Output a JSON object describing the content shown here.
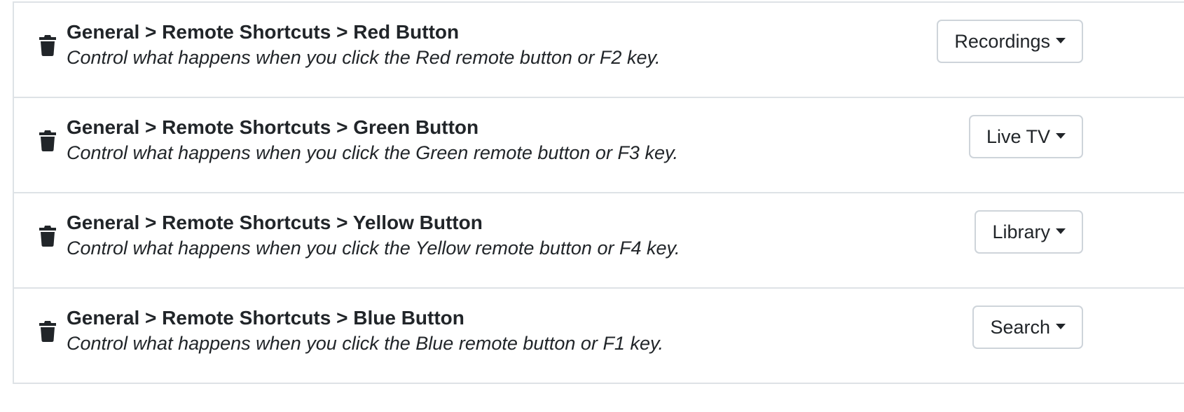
{
  "settings": [
    {
      "title": "General > Remote Shortcuts > Red Button",
      "description": "Control what happens when you click the Red remote button or F2 key.",
      "selected": "Recordings",
      "delete_icon": "trash-icon",
      "caret_icon": "caret-down-icon"
    },
    {
      "title": "General > Remote Shortcuts > Green Button",
      "description": "Control what happens when you click the Green remote button or F3 key.",
      "selected": "Live TV",
      "delete_icon": "trash-icon",
      "caret_icon": "caret-down-icon"
    },
    {
      "title": "General > Remote Shortcuts > Yellow Button",
      "description": "Control what happens when you click the Yellow remote button or F4 key.",
      "selected": "Library",
      "delete_icon": "trash-icon",
      "caret_icon": "caret-down-icon"
    },
    {
      "title": "General > Remote Shortcuts > Blue Button",
      "description": "Control what happens when you click the Blue remote button or F1 key.",
      "selected": "Search",
      "delete_icon": "trash-icon",
      "caret_icon": "caret-down-icon"
    }
  ],
  "colors": {
    "text": "#212529",
    "border": "#dee2e6",
    "button_border": "#ced4da",
    "background": "#ffffff"
  }
}
